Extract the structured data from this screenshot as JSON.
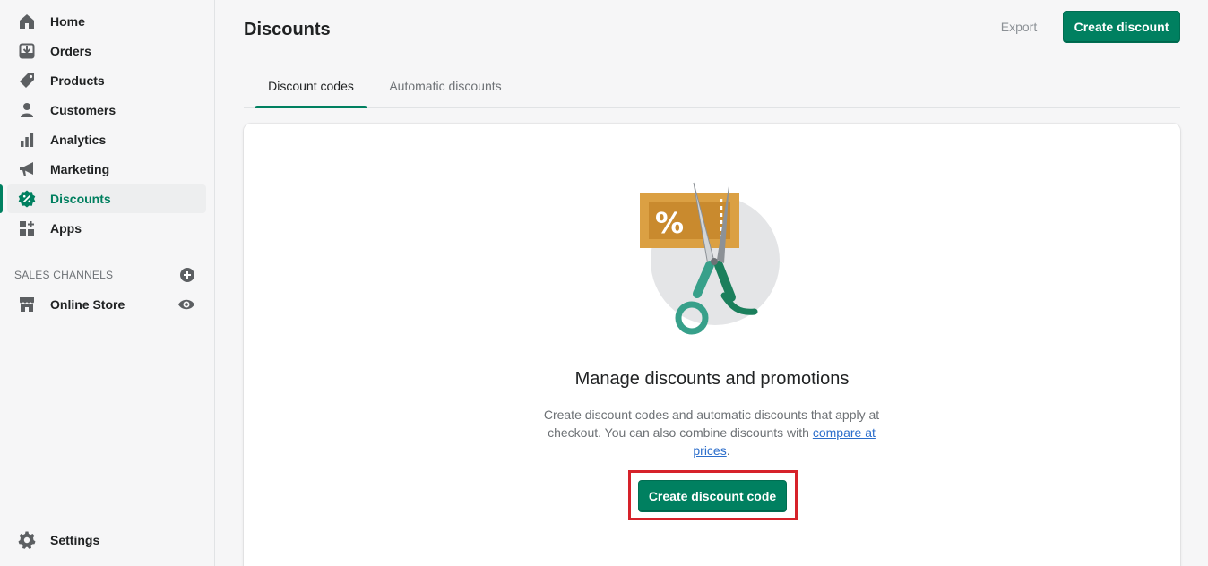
{
  "sidebar": {
    "items": [
      {
        "label": "Home",
        "icon": "home-icon"
      },
      {
        "label": "Orders",
        "icon": "orders-icon"
      },
      {
        "label": "Products",
        "icon": "tag-icon"
      },
      {
        "label": "Customers",
        "icon": "person-icon"
      },
      {
        "label": "Analytics",
        "icon": "bar-chart-icon"
      },
      {
        "label": "Marketing",
        "icon": "megaphone-icon"
      },
      {
        "label": "Discounts",
        "icon": "discount-badge-icon",
        "active": true
      },
      {
        "label": "Apps",
        "icon": "apps-icon"
      }
    ],
    "sales_channels_heading": "SALES CHANNELS",
    "channels": [
      {
        "label": "Online Store",
        "icon": "store-icon"
      }
    ],
    "settings_label": "Settings"
  },
  "header": {
    "title": "Discounts",
    "export_label": "Export",
    "create_label": "Create discount"
  },
  "tabs": [
    {
      "label": "Discount codes",
      "selected": true
    },
    {
      "label": "Automatic discounts",
      "selected": false
    }
  ],
  "empty_state": {
    "title": "Manage discounts and promotions",
    "description": "Create discount codes and automatic discounts that apply at checkout. You can also combine discounts with",
    "link_text": "compare at prices",
    "trailing": ".",
    "button_label": "Create discount code"
  },
  "colors": {
    "accent": "#008060",
    "highlight_box": "#d6222a",
    "link": "#2c6ecb"
  }
}
